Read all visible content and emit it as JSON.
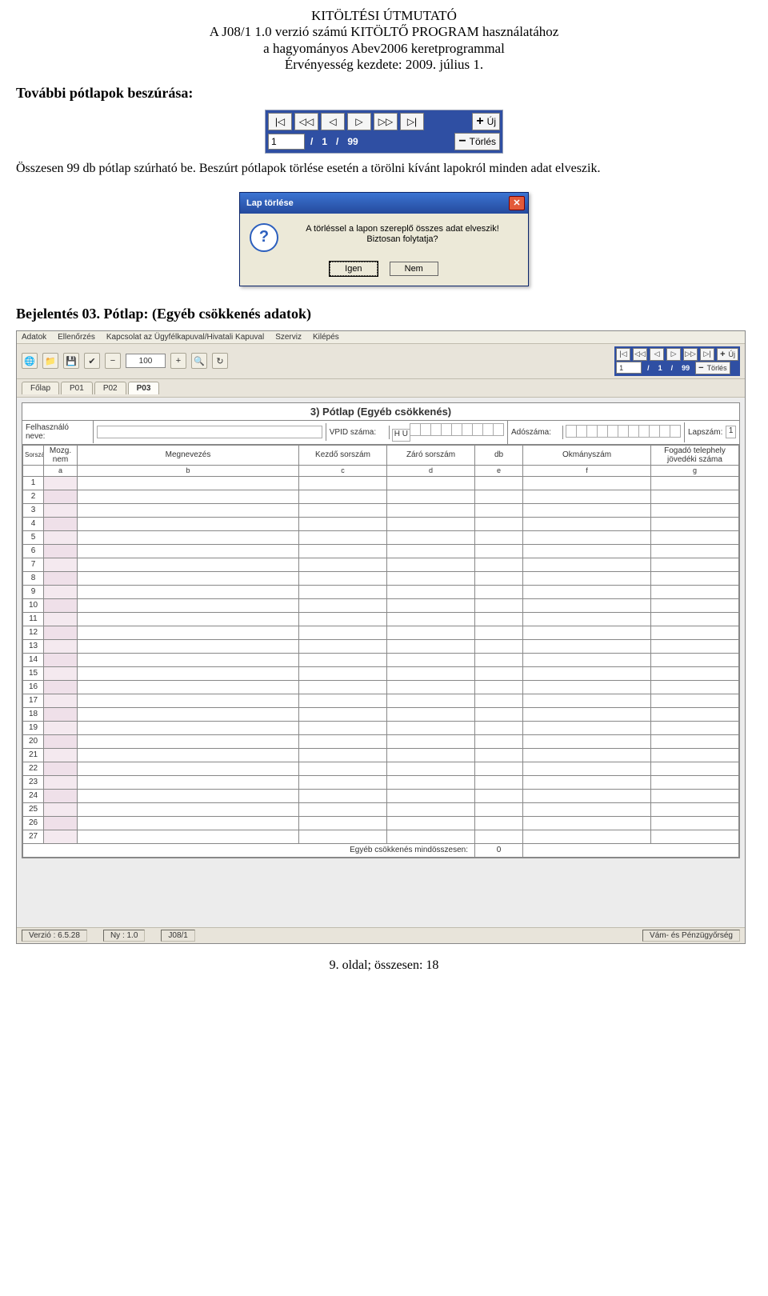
{
  "header": {
    "line1": "KITÖLTÉSI ÚTMUTATÓ",
    "line2": "A J08/1 1.0 verzió számú KITÖLTŐ PROGRAM használatához",
    "line3": "a hagyományos Abev2006 keretprogrammal",
    "line4": "Érvényesség kezdete: 2009. július 1."
  },
  "section1_title": "További pótlapok beszúrása:",
  "pager": {
    "first": "|◁",
    "fastprev": "◁◁",
    "prev": "◁",
    "next": "▷",
    "fastnext": "▷▷",
    "last": "▷|",
    "add_label": "Új",
    "del_label": "Törlés",
    "current": "1",
    "sep": "/",
    "page": "1",
    "total": "99"
  },
  "paragraph1": "Összesen 99 db pótlap szúrható be. Beszúrt pótlapok törlése esetén a törölni kívánt lapokról minden adat elveszik.",
  "dialog": {
    "title": "Lap törlése",
    "msg1": "A törléssel a lapon szereplő összes adat elveszik!",
    "msg2": "Biztosan folytatja?",
    "yes": "Igen",
    "no": "Nem"
  },
  "section2_title": "Bejelentés 03. Pótlap: (Egyéb csökkenés adatok)",
  "app": {
    "menu": [
      "Adatok",
      "Ellenőrzés",
      "Kapcsolat az Ügyfélkapuval/Hivatali Kapuval",
      "Szerviz",
      "Kilépés"
    ],
    "zoom": "100",
    "mini_pager": {
      "current": "1",
      "page": "1",
      "total": "99",
      "add": "Új",
      "del": "Törlés"
    },
    "tabs_prefix": "Főlap",
    "tabs": [
      "P01",
      "P02",
      "P03"
    ],
    "active_tab": 2
  },
  "form": {
    "title": "3) Pótlap (Egyéb csökkenés)",
    "user_label": "Felhasználó neve:",
    "vpid_label": "VPID száma:",
    "vpid_prefix": "H U",
    "tax_label": "Adószáma:",
    "page_label": "Lapszám:",
    "page_value": "1",
    "columns": {
      "sorszam": "Sorszám",
      "mozgnem": "Mozg. nem",
      "megnevezes": "Megnevezés",
      "kezdo": "Kezdő sorszám",
      "zaro": "Záró sorszám",
      "db": "db",
      "okmany": "Okmányszám",
      "fogado": "Fogadó telephely jövedéki száma"
    },
    "subcols": [
      "a",
      "b",
      "c",
      "d",
      "e",
      "f",
      "g"
    ],
    "rows": [
      "1",
      "2",
      "3",
      "4",
      "5",
      "6",
      "7",
      "8",
      "9",
      "10",
      "11",
      "12",
      "13",
      "14",
      "15",
      "16",
      "17",
      "18",
      "19",
      "20",
      "21",
      "22",
      "23",
      "24",
      "25",
      "26",
      "27"
    ],
    "sum_label": "Egyéb csökkenés mindösszesen:",
    "sum_value": "0"
  },
  "status": {
    "version": "Verzió : 6.5.28",
    "ny": "Ny : 1.0",
    "form_id": "J08/1",
    "org": "Vám- és Pénzügyőrség"
  },
  "footer": "9. oldal; összesen: 18"
}
